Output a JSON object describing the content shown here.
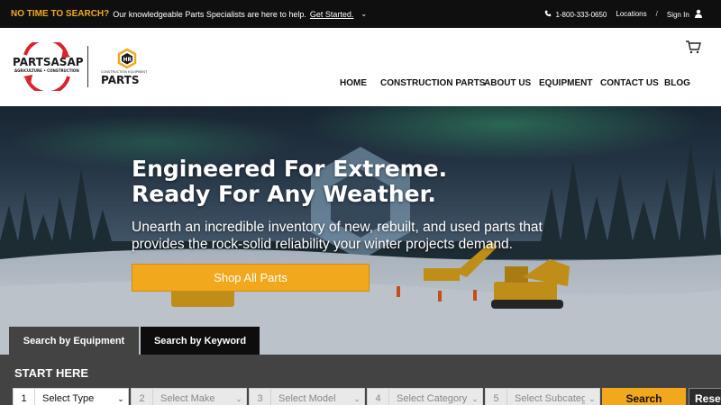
{
  "topbar": {
    "promo_strong": "NO TIME TO SEARCH?",
    "promo_text": "Our knowledgeable Parts Specialists are here to help.",
    "promo_link": "Get Started.",
    "phone": "1-800-333-0650",
    "locations": "Locations",
    "separator": "/",
    "signin": "Sign In"
  },
  "logos": {
    "parts_asap": "PARTSASAP",
    "parts_asap_tagline": "AGRICULTURE • CONSTRUCTION",
    "hr_tagline": "CONSTRUCTION EQUIPMENT",
    "hr_parts": "PARTS"
  },
  "nav": {
    "home": "HOME",
    "construction_parts": "CONSTRUCTION PARTS",
    "about_us": "ABOUT US",
    "equipment": "EQUIPMENT",
    "contact_us": "CONTACT US",
    "blog": "BLOG"
  },
  "hero": {
    "title_line1": "Engineered For Extreme.",
    "title_line2": "Ready For Any Weather.",
    "subtitle_line1": "Unearth an incredible inventory of new, rebuilt, and used parts that",
    "subtitle_line2": "provides the rock-solid reliability your winter projects demand.",
    "cta": "Shop All Parts"
  },
  "search": {
    "tab_equipment": "Search by Equipment",
    "tab_keyword": "Search by Keyword",
    "heading": "START HERE",
    "fields": [
      {
        "num": "1",
        "label": "Select Type"
      },
      {
        "num": "2",
        "label": "Select Make"
      },
      {
        "num": "3",
        "label": "Select Model"
      },
      {
        "num": "4",
        "label": "Select Category"
      },
      {
        "num": "5",
        "label": "Select Subcategory"
      }
    ],
    "search_button": "Search",
    "reset_button": "Reset"
  },
  "colors": {
    "accent": "#f2a81d",
    "topbar_bg": "#0f0f0f",
    "search_bg": "#434343",
    "logo_red": "#d9232e"
  }
}
